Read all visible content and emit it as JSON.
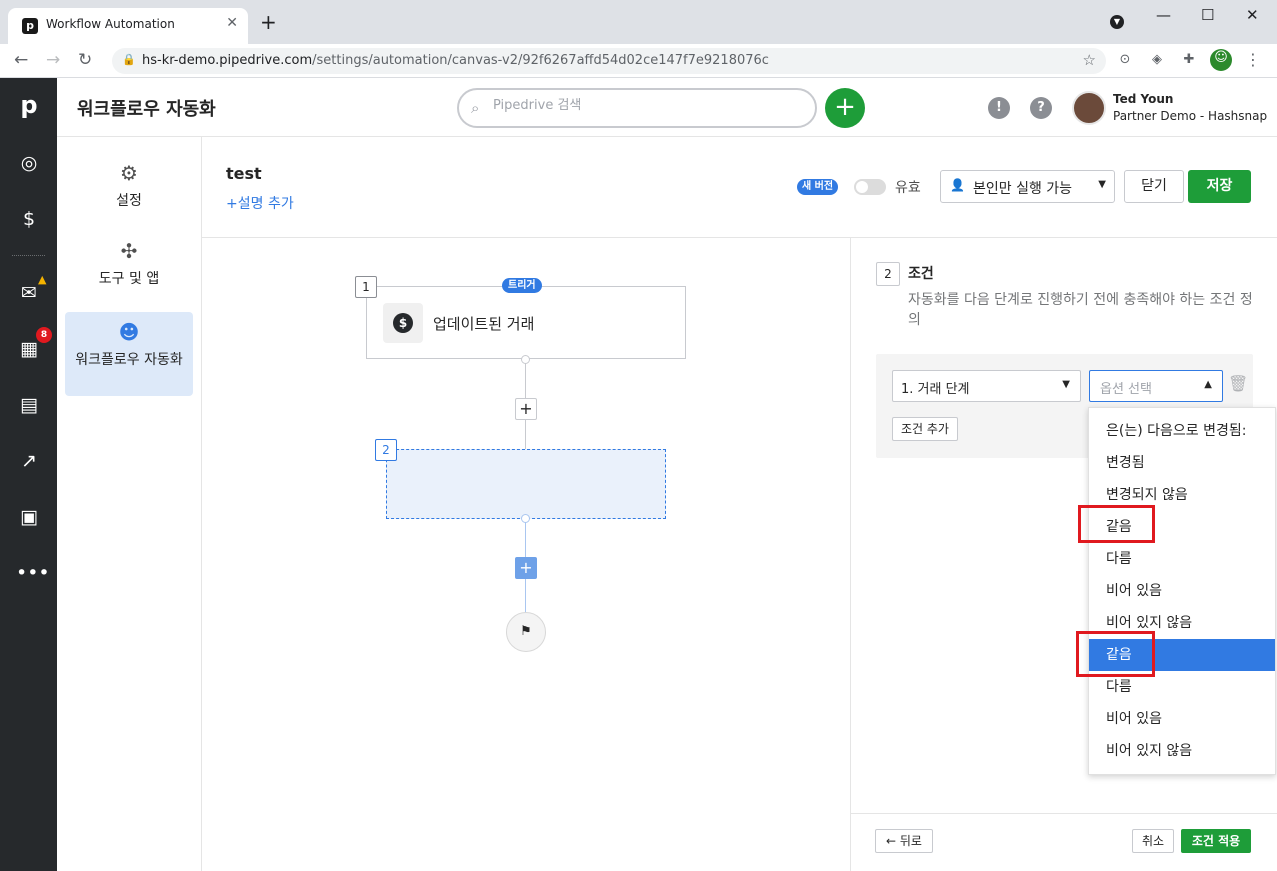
{
  "browser": {
    "tab_title": "Workflow Automation",
    "tab_favicon": "p",
    "url_host": "hs-kr-demo.pipedrive.com",
    "url_path": "/settings/automation/canvas-v2/92f6267affd54d02ce147f7e9218076c"
  },
  "app": {
    "title": "워크플로우 자동화",
    "search_placeholder": "Pipedrive 검색",
    "user_name": "Ted Youn",
    "user_company": "Partner Demo - Hashsnap",
    "calendar_badge": "8"
  },
  "sidebar": {
    "items": [
      {
        "label": "설정",
        "icon": "gear-icon"
      },
      {
        "label": "도구 및 앱",
        "icon": "tools-icon"
      },
      {
        "label": "워크플로우 자동화",
        "icon": "robot-icon",
        "active": true
      }
    ]
  },
  "workflow": {
    "name": "test",
    "add_description": "+설명 추가",
    "new_version_badge": "새 버전",
    "valid_label": "유효",
    "run_permission": "본인만 실행 가능",
    "close_label": "닫기",
    "save_label": "저장"
  },
  "canvas": {
    "trigger_step_number": "1",
    "trigger_badge": "트리거",
    "trigger_name": "업데이트된 거래",
    "step2_number": "2"
  },
  "panel": {
    "step_number": "2",
    "title": "조건",
    "description": "자동화를 다음 단계로 진행하기 전에 충족해야 하는 조건 정의",
    "field_value": "1. 거래 단계",
    "option_placeholder": "옵션 선택",
    "add_condition": "조건 추가",
    "back_label": "뒤로",
    "cancel_label": "취소",
    "apply_label": "조건 적용"
  },
  "dropdown": {
    "options": [
      {
        "label": "은(는) 다음으로 변경됨:",
        "highlighted": false
      },
      {
        "label": "변경됨",
        "highlighted": false
      },
      {
        "label": "변경되지 않음",
        "highlighted": false
      },
      {
        "label": "같음",
        "highlighted": false,
        "annotated": true
      },
      {
        "label": "다름",
        "highlighted": false
      },
      {
        "label": "비어 있음",
        "highlighted": false
      },
      {
        "label": "비어 있지 않음",
        "highlighted": false
      },
      {
        "label": "같음",
        "highlighted": true,
        "annotated": true
      },
      {
        "label": "다름",
        "highlighted": false
      },
      {
        "label": "비어 있음",
        "highlighted": false
      },
      {
        "label": "비어 있지 않음",
        "highlighted": false
      }
    ]
  },
  "colors": {
    "accent_blue": "#317ae2",
    "primary_green": "#1e9d39",
    "rail_dark": "#26292c",
    "annotation_red": "#e0191f"
  }
}
